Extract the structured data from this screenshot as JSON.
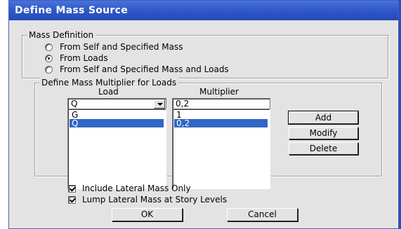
{
  "window": {
    "title": "Define Mass Source"
  },
  "mass_definition": {
    "legend": "Mass Definition",
    "options": [
      {
        "label": "From Self and Specified Mass",
        "checked": false
      },
      {
        "label": "From Loads",
        "checked": true
      },
      {
        "label": "From Self and Specified Mass and Loads",
        "checked": false
      }
    ]
  },
  "multiplier_group": {
    "legend": "Define Mass Multiplier for Loads",
    "load_header": "Load",
    "multiplier_header": "Multiplier",
    "load_value": "Q",
    "multiplier_value": "0,2",
    "rows": [
      {
        "load": "G",
        "multiplier": "1",
        "selected": false
      },
      {
        "load": "Q",
        "multiplier": "0,2",
        "selected": true
      }
    ],
    "add_label": "Add",
    "modify_label": "Modify",
    "delete_label": "Delete"
  },
  "checkboxes": {
    "include_lateral": {
      "label": "Include Lateral Mass Only",
      "checked": true
    },
    "lump_lateral": {
      "label": "Lump Lateral Mass at Story Levels",
      "checked": true
    }
  },
  "footer": {
    "ok_label": "OK",
    "cancel_label": "Cancel"
  }
}
